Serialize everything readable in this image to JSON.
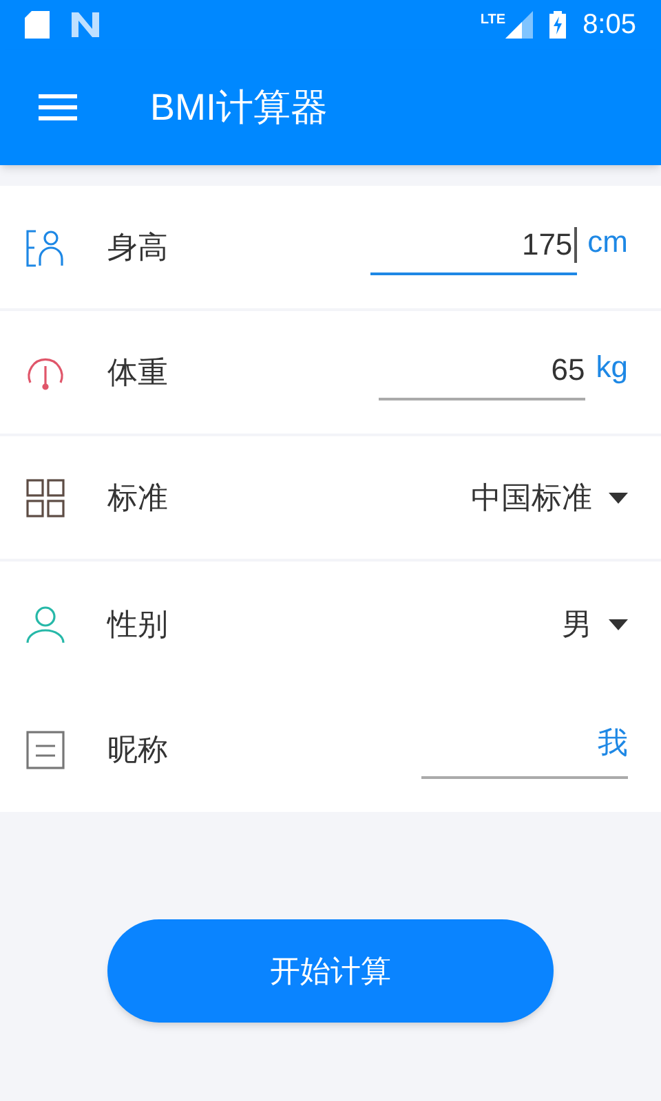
{
  "status_bar": {
    "time": "8:05",
    "network": "LTE"
  },
  "toolbar": {
    "title": "BMI计算器"
  },
  "rows": [
    {
      "kind": "number",
      "label": "身高",
      "value": "175",
      "unit": "cm",
      "focused": true,
      "divider": true
    },
    {
      "kind": "number",
      "label": "体重",
      "value": "65",
      "unit": "kg",
      "focused": false,
      "divider": true
    },
    {
      "kind": "select",
      "label": "标准",
      "value": "中国标准",
      "divider": true
    },
    {
      "kind": "select",
      "label": "性别",
      "value": "男",
      "divider": false
    },
    {
      "kind": "text",
      "label": "昵称",
      "value": "我",
      "focused": false,
      "divider": false
    }
  ],
  "button": {
    "label": "开始计算"
  }
}
